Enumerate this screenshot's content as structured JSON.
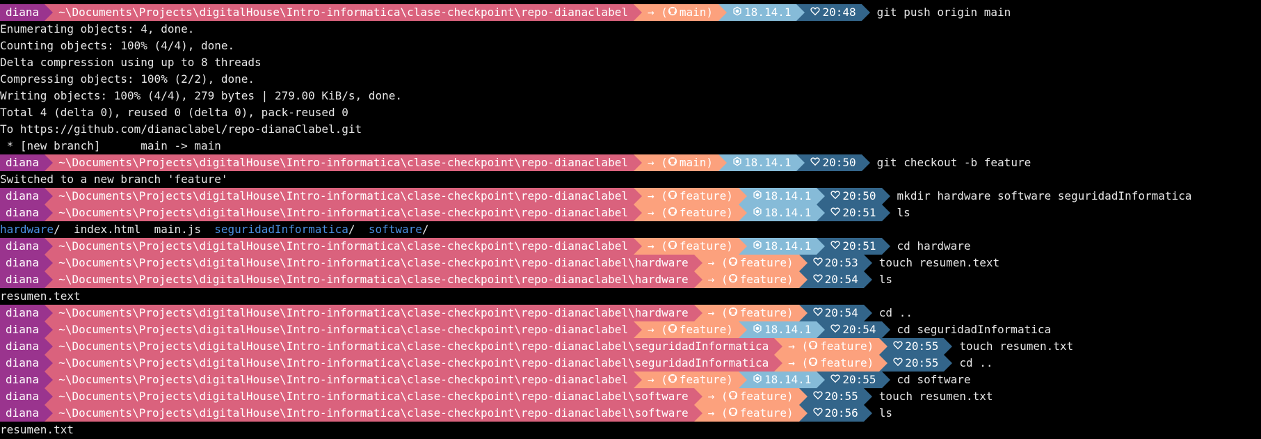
{
  "colors": {
    "user": "#9a348e",
    "path": "#da627d",
    "git": "#fca17d",
    "node": "#86bbd8",
    "time": "#33658a",
    "dir": "#4a90e2"
  },
  "lines": [
    {
      "type": "prompt",
      "user": "diana",
      "path": "~\\Documents\\Projects\\digitalHouse\\Intro-informatica\\clase-checkpoint\\repo-dianaclabel",
      "git": "→ (main)",
      "node": "18.14.1",
      "time": "20:48",
      "cmd": "git push origin main"
    },
    {
      "type": "out",
      "text": "Enumerating objects: 4, done."
    },
    {
      "type": "out",
      "text": "Counting objects: 100% (4/4), done."
    },
    {
      "type": "out",
      "text": "Delta compression using up to 8 threads"
    },
    {
      "type": "out",
      "text": "Compressing objects: 100% (2/2), done."
    },
    {
      "type": "out",
      "text": "Writing objects: 100% (4/4), 279 bytes | 279.00 KiB/s, done."
    },
    {
      "type": "out",
      "text": "Total 4 (delta 0), reused 0 (delta 0), pack-reused 0"
    },
    {
      "type": "out",
      "text": "To https://github.com/dianaclabel/repo-dianaClabel.git"
    },
    {
      "type": "out",
      "text": " * [new branch]      main -> main"
    },
    {
      "type": "prompt",
      "user": "diana",
      "path": "~\\Documents\\Projects\\digitalHouse\\Intro-informatica\\clase-checkpoint\\repo-dianaclabel",
      "git": "→ (main)",
      "node": "18.14.1",
      "time": "20:50",
      "cmd": "git checkout -b feature"
    },
    {
      "type": "out",
      "text": "Switched to a new branch 'feature'"
    },
    {
      "type": "prompt",
      "user": "diana",
      "path": "~\\Documents\\Projects\\digitalHouse\\Intro-informatica\\clase-checkpoint\\repo-dianaclabel",
      "git": "→ (feature)",
      "node": "18.14.1",
      "time": "20:50",
      "cmd": "mkdir hardware software seguridadInformatica"
    },
    {
      "type": "prompt",
      "user": "diana",
      "path": "~\\Documents\\Projects\\digitalHouse\\Intro-informatica\\clase-checkpoint\\repo-dianaclabel",
      "git": "→ (feature)",
      "node": "18.14.1",
      "time": "20:51",
      "cmd": "ls"
    },
    {
      "type": "ls",
      "items": [
        {
          "text": "hardware",
          "kind": "dir"
        },
        {
          "text": "/  ",
          "kind": "plain"
        },
        {
          "text": "index.html  main.js  ",
          "kind": "plain"
        },
        {
          "text": "seguridadInformatica",
          "kind": "dir"
        },
        {
          "text": "/  ",
          "kind": "plain"
        },
        {
          "text": "software",
          "kind": "dir"
        },
        {
          "text": "/",
          "kind": "plain"
        }
      ]
    },
    {
      "type": "prompt",
      "user": "diana",
      "path": "~\\Documents\\Projects\\digitalHouse\\Intro-informatica\\clase-checkpoint\\repo-dianaclabel",
      "git": "→ (feature)",
      "node": "18.14.1",
      "time": "20:51",
      "cmd": "cd hardware"
    },
    {
      "type": "prompt",
      "user": "diana",
      "path": "~\\Documents\\Projects\\digitalHouse\\Intro-informatica\\clase-checkpoint\\repo-dianaclabel\\hardware",
      "git": "→ (feature)",
      "node": "",
      "time": "20:53",
      "cmd": "touch resumen.text"
    },
    {
      "type": "prompt",
      "user": "diana",
      "path": "~\\Documents\\Projects\\digitalHouse\\Intro-informatica\\clase-checkpoint\\repo-dianaclabel\\hardware",
      "git": "→ (feature)",
      "node": "",
      "time": "20:54",
      "cmd": "ls"
    },
    {
      "type": "out",
      "text": "resumen.text"
    },
    {
      "type": "prompt",
      "user": "diana",
      "path": "~\\Documents\\Projects\\digitalHouse\\Intro-informatica\\clase-checkpoint\\repo-dianaclabel\\hardware",
      "git": "→ (feature)",
      "node": "",
      "time": "20:54",
      "cmd": "cd .."
    },
    {
      "type": "prompt",
      "user": "diana",
      "path": "~\\Documents\\Projects\\digitalHouse\\Intro-informatica\\clase-checkpoint\\repo-dianaclabel",
      "git": "→ (feature)",
      "node": "18.14.1",
      "time": "20:54",
      "cmd": "cd seguridadInformatica"
    },
    {
      "type": "prompt",
      "user": "diana",
      "path": "~\\Documents\\Projects\\digitalHouse\\Intro-informatica\\clase-checkpoint\\repo-dianaclabel\\seguridadInformatica",
      "git": "→ (feature)",
      "node": "",
      "time": "20:55",
      "cmd": "touch resumen.txt"
    },
    {
      "type": "prompt",
      "user": "diana",
      "path": "~\\Documents\\Projects\\digitalHouse\\Intro-informatica\\clase-checkpoint\\repo-dianaclabel\\seguridadInformatica",
      "git": "→ (feature)",
      "node": "",
      "time": "20:55",
      "cmd": "cd .."
    },
    {
      "type": "prompt",
      "user": "diana",
      "path": "~\\Documents\\Projects\\digitalHouse\\Intro-informatica\\clase-checkpoint\\repo-dianaclabel",
      "git": "→ (feature)",
      "node": "18.14.1",
      "time": "20:55",
      "cmd": "cd software"
    },
    {
      "type": "prompt",
      "user": "diana",
      "path": "~\\Documents\\Projects\\digitalHouse\\Intro-informatica\\clase-checkpoint\\repo-dianaclabel\\software",
      "git": "→ (feature)",
      "node": "",
      "time": "20:55",
      "cmd": "touch resumen.txt"
    },
    {
      "type": "prompt",
      "user": "diana",
      "path": "~\\Documents\\Projects\\digitalHouse\\Intro-informatica\\clase-checkpoint\\repo-dianaclabel\\software",
      "git": "→ (feature)",
      "node": "",
      "time": "20:56",
      "cmd": "ls"
    },
    {
      "type": "out",
      "text": "resumen.txt"
    }
  ]
}
